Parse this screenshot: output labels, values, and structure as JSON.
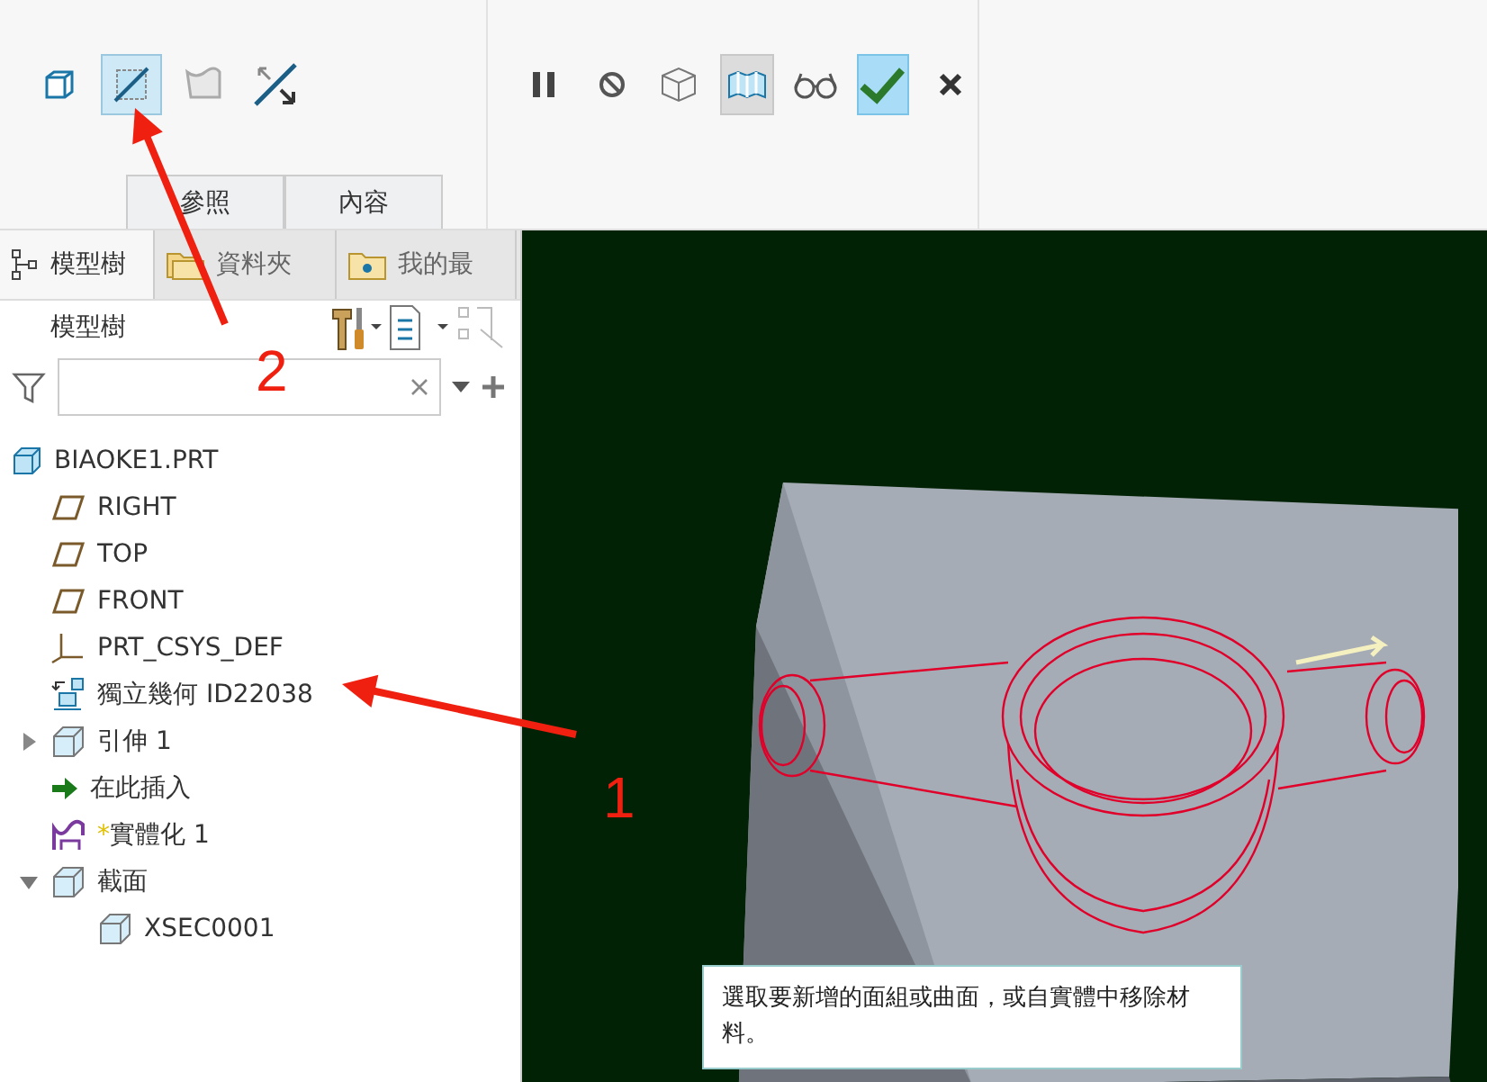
{
  "toolbar": {
    "groups": [
      {
        "buttons": [
          {
            "kind": "solid",
            "selected": false
          },
          {
            "kind": "trim",
            "selected": true
          },
          {
            "kind": "surface",
            "selected": false
          },
          {
            "kind": "flip",
            "selected": false
          }
        ]
      },
      {
        "buttons": [
          {
            "kind": "pause",
            "selected": false
          },
          {
            "kind": "stop",
            "selected": false
          },
          {
            "kind": "verify",
            "selected": false
          },
          {
            "kind": "preview",
            "selected": true
          },
          {
            "kind": "glasses",
            "selected": false
          },
          {
            "kind": "ok",
            "selected": false
          },
          {
            "kind": "cancel",
            "selected": false
          }
        ]
      }
    ],
    "panel_tabs": [
      {
        "label": "參照",
        "selected": false
      },
      {
        "label": "內容",
        "selected": false
      }
    ]
  },
  "navigator": {
    "tabs": [
      {
        "label": "模型樹",
        "kind": "tree",
        "selected": true
      },
      {
        "label": "資料夾",
        "kind": "folder",
        "selected": false
      },
      {
        "label": "我的最",
        "kind": "favorite",
        "selected": false
      }
    ],
    "title": "模型樹",
    "tree": [
      {
        "label": "BIAOKE1.PRT",
        "kind": "part",
        "children": [
          {
            "label": "RIGHT",
            "kind": "plane"
          },
          {
            "label": "TOP",
            "kind": "plane"
          },
          {
            "label": "FRONT",
            "kind": "plane"
          },
          {
            "label": "PRT_CSYS_DEF",
            "kind": "csys"
          },
          {
            "label": "獨立幾何 ID22038",
            "kind": "geometry"
          },
          {
            "label": "引伸 1",
            "kind": "extrude",
            "expanded": false
          },
          {
            "label": "在此插入",
            "kind": "insert"
          },
          {
            "label": "實體化 1",
            "kind": "solidify",
            "marker": "*"
          },
          {
            "label": "截面",
            "kind": "section",
            "expanded": true,
            "children": [
              {
                "label": "XSEC0001",
                "kind": "section"
              }
            ]
          }
        ]
      }
    ]
  },
  "tooltip": "選取要新增的面組或曲面，或自實體中移除材料。",
  "annotations": [
    {
      "label": "1"
    },
    {
      "label": "2"
    }
  ]
}
